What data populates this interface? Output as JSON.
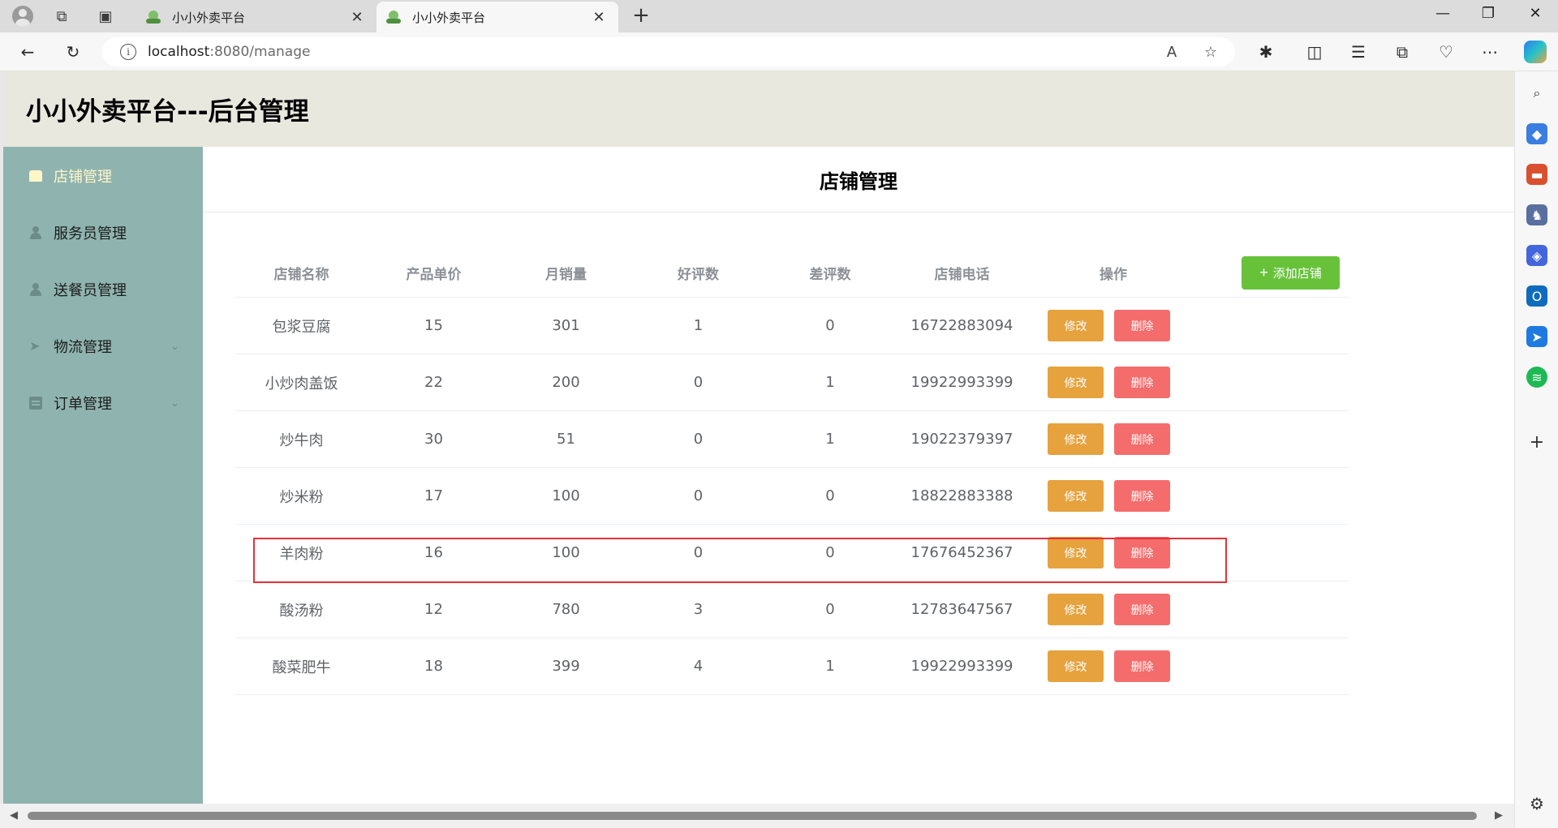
{
  "browser": {
    "tabs": [
      {
        "title": "小小外卖平台",
        "close": "✕"
      },
      {
        "title": "小小外卖平台",
        "close": "✕"
      }
    ],
    "new_tab": "+",
    "window": {
      "minimize": "—",
      "restore": "❐",
      "close": "✕"
    },
    "nav": {
      "back": "←",
      "refresh": "↻"
    },
    "url_host": "localhost",
    "url_rest": ":8080/manage",
    "icons": [
      "read-aloud-icon",
      "favorite-star-icon",
      "extensions-icon",
      "split-screen-icon",
      "favorites-icon",
      "collections-icon",
      "browser-essentials-icon",
      "more-icon",
      "copilot-icon"
    ]
  },
  "app": {
    "title": "小小外卖平台---后台管理"
  },
  "sidebar": {
    "items": [
      {
        "label": "店铺管理",
        "icon": "store-icon",
        "active": true
      },
      {
        "label": "服务员管理",
        "icon": "user-icon"
      },
      {
        "label": "送餐员管理",
        "icon": "courier-icon"
      },
      {
        "label": "物流管理",
        "icon": "paper-plane-icon",
        "arrow": "⌄"
      },
      {
        "label": "订单管理",
        "icon": "clipboard-icon",
        "arrow": "⌄"
      }
    ]
  },
  "main": {
    "title": "店铺管理",
    "add_button": "添加店铺",
    "columns": [
      "店铺名称",
      "产品单价",
      "月销量",
      "好评数",
      "差评数",
      "店铺电话",
      "操作"
    ],
    "edit_label": "修改",
    "delete_label": "删除",
    "rows": [
      [
        "包浆豆腐",
        "15",
        "301",
        "1",
        "0",
        "16722883094"
      ],
      [
        "小炒肉盖饭",
        "22",
        "200",
        "0",
        "1",
        "19922993399"
      ],
      [
        "炒牛肉",
        "30",
        "51",
        "0",
        "1",
        "19022379397"
      ],
      [
        "炒米粉",
        "17",
        "100",
        "0",
        "0",
        "18822883388"
      ],
      [
        "羊肉粉",
        "16",
        "100",
        "0",
        "0",
        "17676452367"
      ],
      [
        "酸汤粉",
        "12",
        "780",
        "3",
        "0",
        "12783647567"
      ],
      [
        "酸菜肥牛",
        "18",
        "399",
        "4",
        "1",
        "19922993399"
      ]
    ]
  },
  "colors": {
    "header_bg": "#e8e8de",
    "sidebar_bg": "#8fb4b0",
    "active_menu": "#fff6c8",
    "add_button": "#67c23a",
    "edit_button": "#e6a23c",
    "delete_button": "#f56c6c",
    "highlight_border": "#e3333a"
  }
}
